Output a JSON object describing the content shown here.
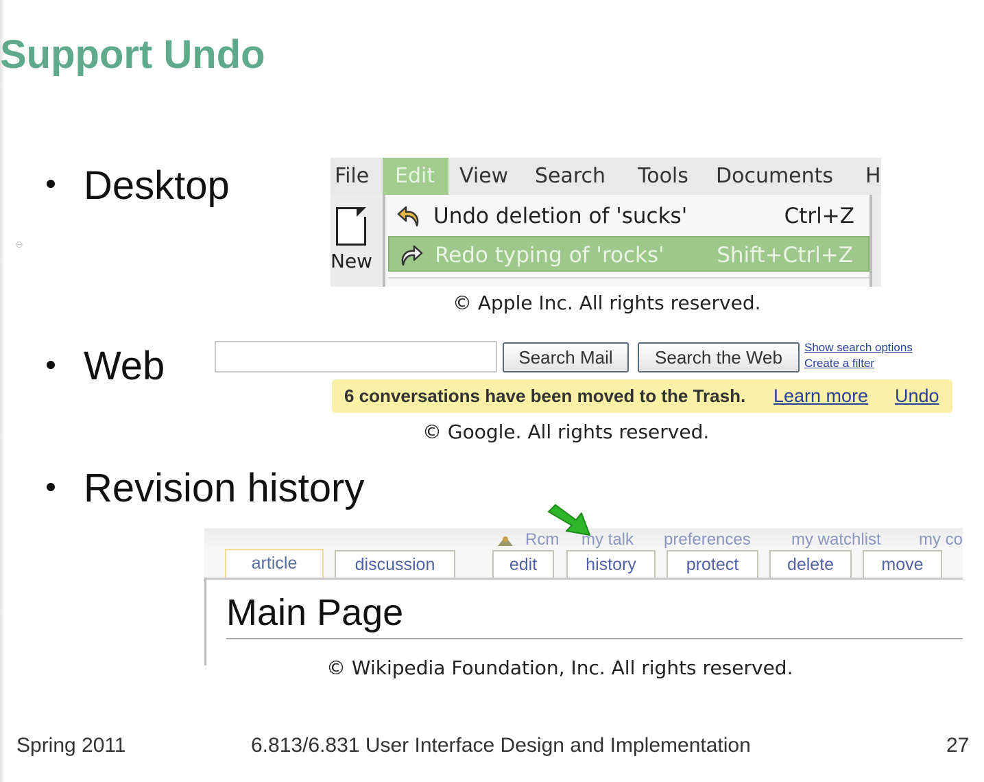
{
  "slide": {
    "title": "Support Undo",
    "bullets": [
      "Desktop",
      "Web",
      "Revision history"
    ]
  },
  "desktop_example": {
    "menus": [
      {
        "label": "File",
        "state": "normal"
      },
      {
        "label": "Edit",
        "state": "open"
      },
      {
        "label": "View",
        "state": "normal"
      },
      {
        "label": "Search",
        "state": "normal"
      },
      {
        "label": "Tools",
        "state": "normal"
      },
      {
        "label": "Documents",
        "state": "normal"
      },
      {
        "label": "H",
        "state": "normal"
      }
    ],
    "toolbar_new_label": "New",
    "menu_items": [
      {
        "label": "Undo deletion of 'sucks'",
        "shortcut": "Ctrl+Z",
        "icon": "undo-icon",
        "highlighted": false
      },
      {
        "label": "Redo typing of 'rocks'",
        "shortcut": "Shift+Ctrl+Z",
        "icon": "redo-icon",
        "highlighted": true
      }
    ],
    "caption": "© Apple Inc. All rights reserved."
  },
  "web_example": {
    "search_value": "",
    "buttons": [
      "Search Mail",
      "Search the Web"
    ],
    "links": [
      "Show search options",
      "Create a filter"
    ],
    "notice": "6 conversations have been moved to the Trash.",
    "notice_links": [
      "Learn more",
      "Undo"
    ],
    "caption": "© Google. All rights reserved."
  },
  "revision_example": {
    "personal_links": [
      "Rcm",
      "my talk",
      "preferences",
      "my watchlist",
      "my co"
    ],
    "tabs": [
      {
        "label": "article",
        "active": true
      },
      {
        "label": "discussion",
        "active": false
      },
      {
        "label": "edit",
        "active": false
      },
      {
        "label": "history",
        "active": false
      },
      {
        "label": "protect",
        "active": false
      },
      {
        "label": "delete",
        "active": false
      },
      {
        "label": "move",
        "active": false
      }
    ],
    "page_title": "Main Page",
    "caption": "© Wikipedia Foundation, Inc. All rights reserved."
  },
  "footer": {
    "left": "Spring 2011",
    "center": "6.813/6.831 User Interface Design and Implementation",
    "page_number": "27"
  },
  "colors": {
    "title": "#5fa98c",
    "menu_highlight": "#9ec78c",
    "notice_background": "#faf0a6",
    "link": "#2a3f9a",
    "arrow": "#2fb52a"
  }
}
